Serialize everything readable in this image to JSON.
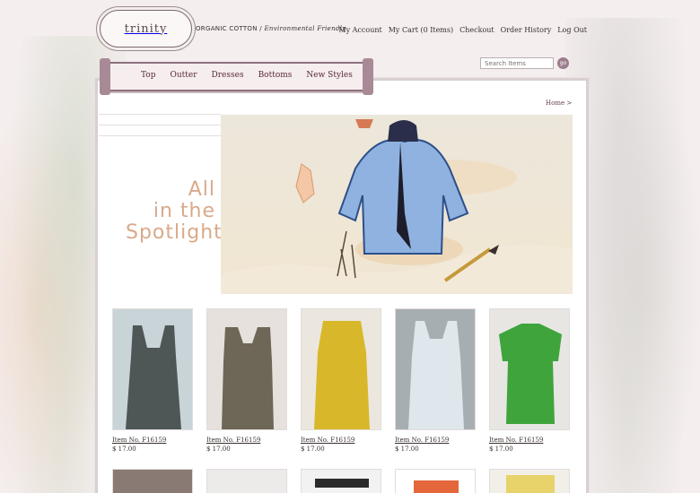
{
  "brand": {
    "logo_text": "trinity",
    "tagline_main": "ORGANIC COTTON /",
    "tagline_emphasis": "Environmental Friendly"
  },
  "account_nav": [
    "My Account",
    "My Cart (0 Items)",
    "Checkout",
    "Order History",
    "Log Out"
  ],
  "search": {
    "placeholder": "Search Items",
    "button_label": "go"
  },
  "main_nav": [
    "Top",
    "Outter",
    "Dresses",
    "Bottoms",
    "New Styles"
  ],
  "breadcrumb": "Home >",
  "spotlight": {
    "line1": "All",
    "line2": "in the",
    "line3": "Spotlight"
  },
  "products": [
    {
      "name": "Item No. F16159",
      "price": "$ 17.00",
      "color": "#4e5656"
    },
    {
      "name": "Item No. F16159",
      "price": "$ 17.00",
      "color": "#6e6656"
    },
    {
      "name": "Item No. F16159",
      "price": "$ 17.00",
      "color": "#d8b82a"
    },
    {
      "name": "Item No. F16159",
      "price": "$ 17.00",
      "color": "#dfe7ec"
    },
    {
      "name": "Item No. F16159",
      "price": "$ 17.00",
      "color": "#3fa43c"
    }
  ],
  "row2_colors": [
    "#8a7a74",
    "#ecebea",
    "#2b2b2b",
    "#e3673b",
    "#e8d26a"
  ],
  "colors": {
    "accent": "#5a2a36",
    "ribbon_border": "#8c6f7c",
    "go_button": "#9b7d8c",
    "background": "#f4eeee"
  }
}
